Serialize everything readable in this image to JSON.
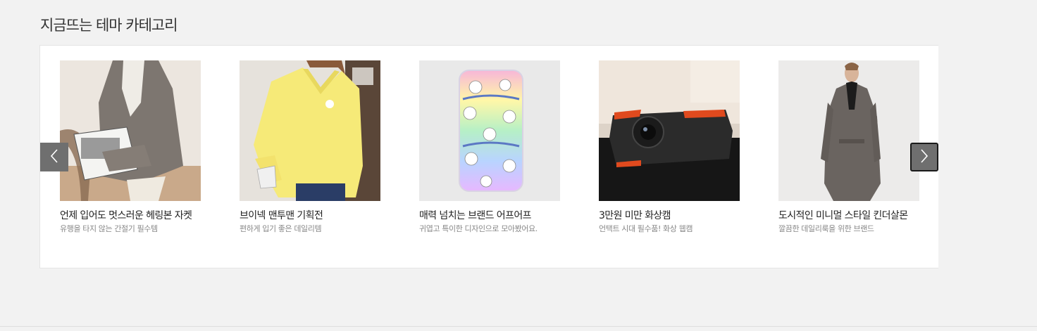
{
  "section": {
    "title": "지금뜨는 테마 카테고리"
  },
  "cards": [
    {
      "title": "언제 입어도 멋스러운 헤링본 자켓",
      "subtitle": "유행을 타지 않는 간절기 필수템",
      "image": "herringbone-jacket-photo"
    },
    {
      "title": "브이넥 맨투맨 기획전",
      "subtitle": "편하게 입기 좋은 데일리템",
      "image": "yellow-sweatshirt-photo"
    },
    {
      "title": "매력 넘치는 브랜드 어프어프",
      "subtitle": "귀엽고 특이한 디자인으로 모아봤어요.",
      "image": "bear-phone-case-photo"
    },
    {
      "title": "3만원 미만 화상캠",
      "subtitle": "언택트 시대 필수품! 화상 웹캠",
      "image": "webcam-photo"
    },
    {
      "title": "도시적인 미니멀 스타일 킨더살몬",
      "subtitle": "깔끔한 데일리룩을 위한 브랜드",
      "image": "grey-coat-photo"
    }
  ],
  "nav": {
    "prev_icon": "chevron-left-icon",
    "next_icon": "chevron-right-icon"
  },
  "colors": {
    "background": "#f2f2f2",
    "panel": "#ffffff",
    "arrow": "#6f6f6f",
    "title": "#333333",
    "subtitle": "#888888"
  }
}
